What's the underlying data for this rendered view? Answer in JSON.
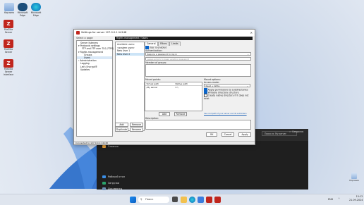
{
  "desktop": {
    "icons": [
      {
        "label": "Корзина"
      },
      {
        "label": "Microsoft Edge"
      },
      {
        "label": "Microsoft Edge"
      },
      {
        "label": "FileZilla Server"
      },
      {
        "label": "FileZilla Server"
      },
      {
        "label": "FileZilla Server Interface"
      }
    ],
    "recycle_bin_label": "Корзина"
  },
  "dialog": {
    "title": "Settings for server 127.0.0.1:14148",
    "select_page_label": "Select a page:",
    "tree": [
      "Server listeners",
      "Protocols settings",
      "FTP and FTP over TLS (FTPS)",
      "Rights management",
      "Groups",
      "Users",
      "Administration",
      "Logging",
      "Let's Encrypt®",
      "Updates"
    ],
    "header": "Rights management / Users",
    "available_users_label": "Available users:",
    "users": [
      "<system user>",
      "New User 1",
      "New User 2"
    ],
    "buttons": {
      "add": "Add",
      "remove": "Remove",
      "duplicate": "Duplicate",
      "rename": "Rename",
      "mp_add": "Add",
      "mp_remove": "Remove",
      "ok": "OK",
      "cancel": "Cancel",
      "apply": "Apply"
    },
    "tabs": [
      "General",
      "Filters",
      "Limits"
    ],
    "user_enabled": "User is enabled",
    "authentication_label": "Authentication:",
    "auth_select": "Require a password to log in",
    "password_placeholder": "Leave empty to keep existing password",
    "member_of_groups": "Member of groups:",
    "mount_points_label": "Mount points:",
    "mp_headers": [
      "Virtual path",
      "Native path"
    ],
    "mp_row": [
      "/My server",
      "C:\\"
    ],
    "mount_options_label": "Mount options:",
    "access_mode_label": "Access mode:",
    "access_mode_value": "Read + Write",
    "opt1": "Apply permissions to subdirectories",
    "opt2": "Writable directory structure",
    "opt3": "Create native directory if it does not exist",
    "link": "Use root path of your server and its subfolders",
    "description_label": "Description:",
    "status": "Connected to 127.0.0.1:14148"
  },
  "explorer": {
    "search": "Поиск в: My server",
    "details": "Сведения",
    "rows": [
      "Главная",
      "Рабочий стол",
      "Загрузки",
      "Документы",
      "Изображения",
      "Музыка",
      "Видео"
    ]
  },
  "taskbar": {
    "search_label": "Поиск",
    "lang": "ENG",
    "time": "15:12",
    "date": "21.09.2024"
  }
}
